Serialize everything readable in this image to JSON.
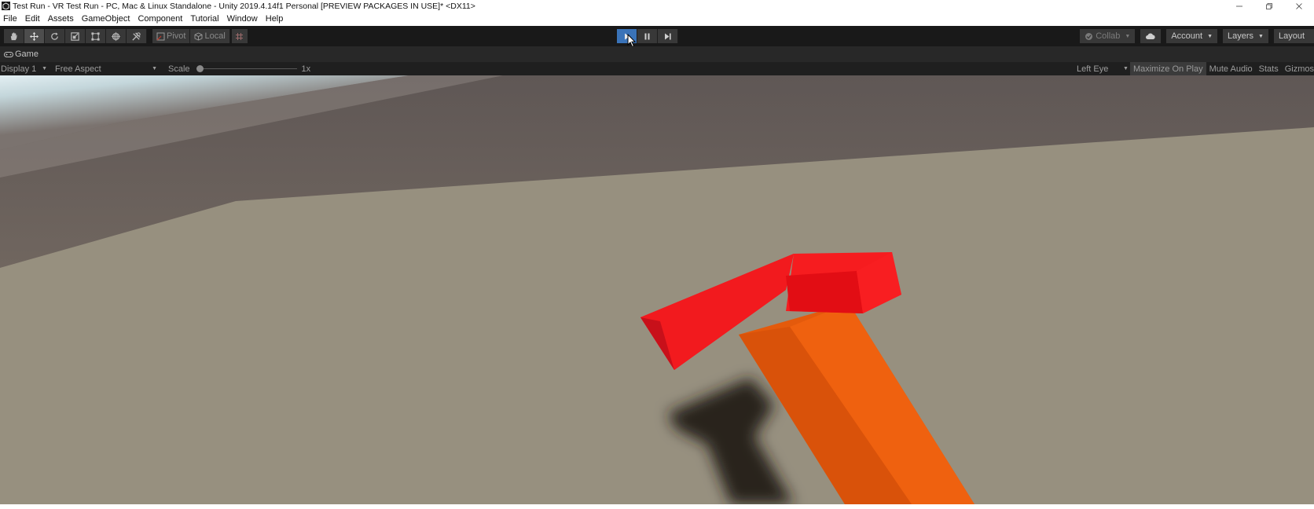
{
  "window": {
    "title": "Test Run - VR Test Run - PC, Mac & Linux Standalone - Unity 2019.4.14f1 Personal [PREVIEW PACKAGES IN USE]* <DX11>"
  },
  "menu": [
    "File",
    "Edit",
    "Assets",
    "GameObject",
    "Component",
    "Tutorial",
    "Window",
    "Help"
  ],
  "toolbar": {
    "transform_tools": [
      {
        "icon": "hand-icon"
      },
      {
        "icon": "move-icon",
        "active": true
      },
      {
        "icon": "rotate-icon"
      },
      {
        "icon": "scale-icon"
      },
      {
        "icon": "rect-icon"
      },
      {
        "icon": "transform-icon"
      },
      {
        "icon": "custom-tools-icon"
      }
    ],
    "pivot_label": "Pivot",
    "local_label": "Local",
    "play_state": "playing",
    "collab_label": "Collab",
    "account_label": "Account",
    "layers_label": "Layers",
    "layout_label": "Layout"
  },
  "game_tab": {
    "label": "Game"
  },
  "game_options": {
    "display": "Display 1",
    "aspect": "Free Aspect",
    "scale_label": "Scale",
    "scale_value": "1x",
    "scale_fraction": 0.0,
    "eye": "Left Eye",
    "maximize_on_play": "Maximize On Play",
    "mute_audio": "Mute Audio",
    "stats": "Stats",
    "gizmos": "Gizmos"
  },
  "colors": {
    "toolbar_bg": "#191919",
    "button_bg": "#383838",
    "play_active": "#3a73b8",
    "floor": "#97907f",
    "wall": "#6b625f",
    "hammer_head": "#f2171b",
    "hammer_handle": "#e9580d"
  }
}
